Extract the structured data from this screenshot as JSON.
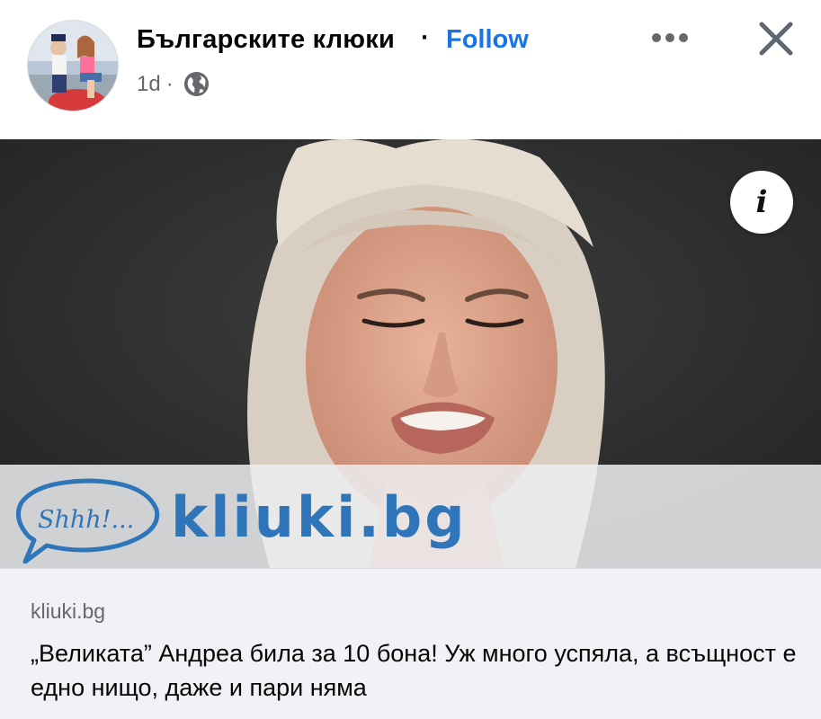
{
  "post": {
    "page_name": "Българските клюки",
    "separator": "·",
    "follow_label": "Follow",
    "time": "1d",
    "meta_separator": "·",
    "audience_icon": "globe-icon",
    "more_icon": "more-options-icon",
    "close_icon": "close-icon"
  },
  "media": {
    "info_label": "i",
    "brand_logo_text": "Shhh!...",
    "brand_text": "kliuki.bg",
    "brand_color": "#2e76b9"
  },
  "link": {
    "domain": "kliuki.bg",
    "headline": "„Великата” Андреа била за 10 бона! Уж много успяла, а всъщност е едно нищо, даже и пари няма"
  },
  "colors": {
    "accent": "#1b74e4",
    "secondary_text": "#65676b",
    "preview_bg": "#f0f2f5"
  }
}
